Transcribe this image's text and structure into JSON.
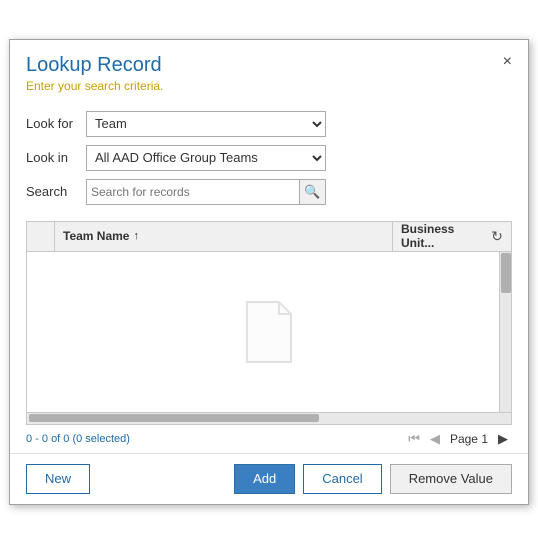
{
  "dialog": {
    "title": "Lookup Record",
    "subtitle": "Enter your search criteria.",
    "close_label": "×"
  },
  "form": {
    "look_for_label": "Look for",
    "look_in_label": "Look in",
    "search_label": "Search",
    "look_for_value": "Team",
    "look_in_value": "All AAD Office Group Teams",
    "look_for_options": [
      "Team"
    ],
    "look_in_options": [
      "All AAD Office Group Teams"
    ],
    "search_placeholder": "Search for records"
  },
  "grid": {
    "col_team_name": "Team Name",
    "col_business_unit": "Business Unit...",
    "sort_direction": "↑",
    "record_count": "0 - 0 of 0 (0 selected)",
    "page_label": "Page 1"
  },
  "footer": {
    "new_label": "New",
    "add_label": "Add",
    "cancel_label": "Cancel",
    "remove_value_label": "Remove Value"
  }
}
